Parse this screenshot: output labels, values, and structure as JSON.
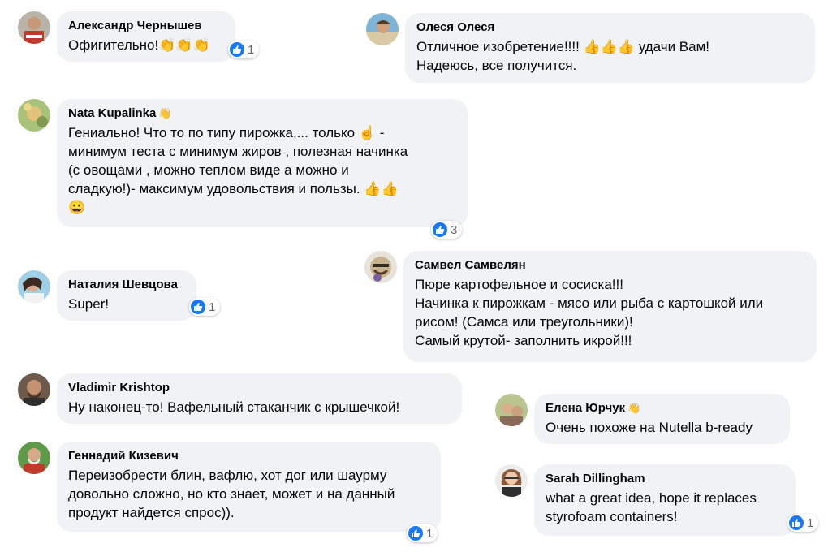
{
  "comments": [
    {
      "name": "Александр Чернышев",
      "lines": [
        "Офигительно!👏👏👏"
      ],
      "likes": "1"
    },
    {
      "name": "Олеся Олеся",
      "lines": [
        "Отличное изобретение!!!! 👍👍👍 удачи Вам!",
        "Надеюсь, все получится."
      ]
    },
    {
      "name": "Nata Kupalinka",
      "badge": "👋",
      "lines": [
        "Гениально! Что то по типу пирожка,... только ☝ -",
        "минимум теста с минимум жиров , полезная начинка",
        "(с овощами , можно теплом виде а можно и",
        "сладкую!)- максимум удовольствия и пользы. 👍👍",
        "😀"
      ],
      "likes": "3"
    },
    {
      "name": "Самвел Самвелян",
      "lines": [
        "Пюре картофельное и сосиска!!!",
        "Начинка к пирожкам - мясо или рыба с картошкой или",
        "рисом! (Самса или треугольники)!",
        "Самый крутой- заполнить икрой!!!"
      ]
    },
    {
      "name": "Наталия Шевцова",
      "lines": [
        "Super!"
      ],
      "likes": "1"
    },
    {
      "name": "Vladimir Krishtop",
      "lines": [
        "Ну наконец-то! Вафельный стаканчик с крышечкой!"
      ]
    },
    {
      "name": "Елена Юрчук",
      "badge": "👋",
      "lines": [
        "Очень похоже на Nutella b-ready"
      ]
    },
    {
      "name": "Геннадий Кизевич",
      "lines": [
        "Переизобрести блин, вафлю, хот дог или шаурму",
        "довольно сложно, но кто знает, может и на данный",
        "продукт найдется спрос))."
      ],
      "likes": "1"
    },
    {
      "name": "Sarah Dillingham",
      "lines": [
        "what a great idea, hope it replaces",
        "styrofoam containers!"
      ],
      "likes": "1"
    }
  ],
  "icons": {
    "reaction": "like-thumb-icon",
    "avatar": "profile-photo"
  },
  "colors": {
    "bubble": "#f0f2f5",
    "like": "#1877f2",
    "text": "#050505",
    "count": "#65676b"
  }
}
